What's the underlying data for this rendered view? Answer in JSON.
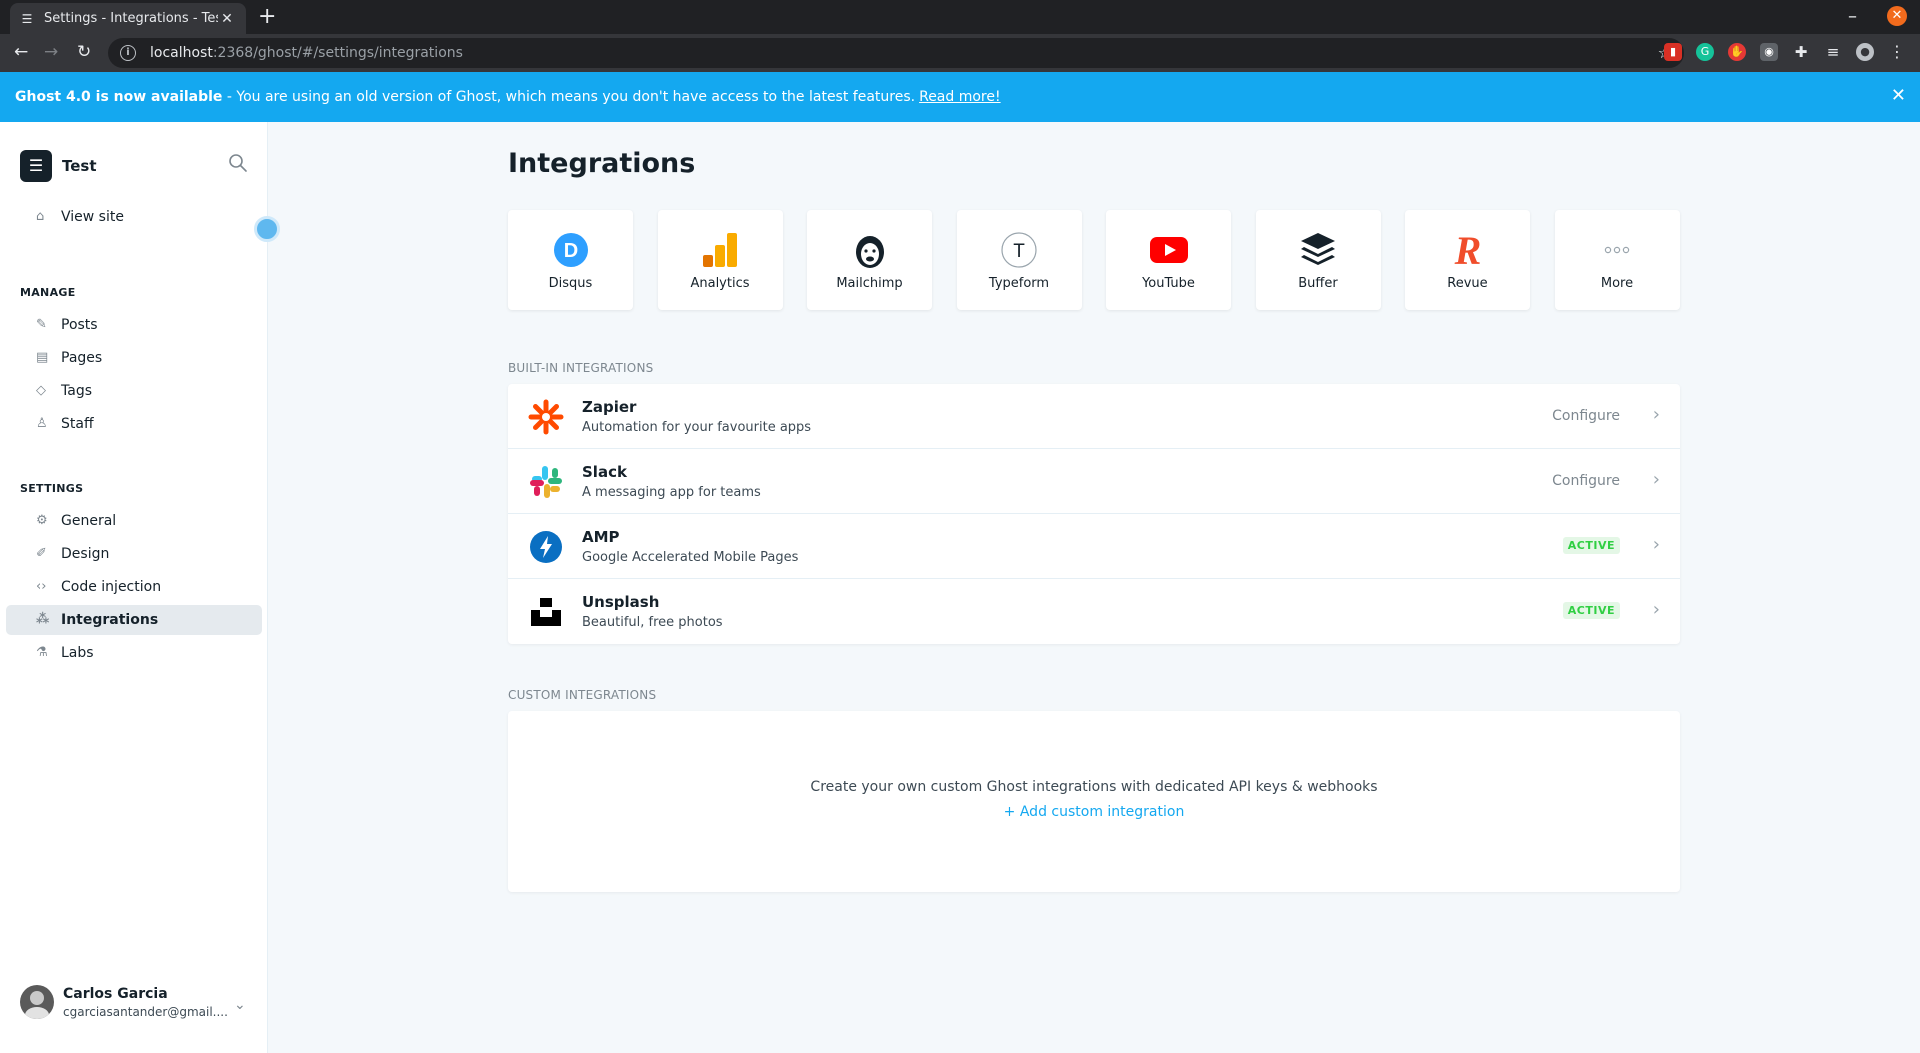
{
  "browser": {
    "tab_title": "Settings - Integrations - Test",
    "url_host": "localhost",
    "url_path": ":2368/ghost/#/settings/integrations"
  },
  "banner": {
    "bold": "Ghost 4.0 is now available",
    "text": " - You are using an old version of Ghost, which means you don't have access to the latest features.",
    "link": "Read more!"
  },
  "sidebar": {
    "site_name": "Test",
    "view_site": "View site",
    "manage_label": "MANAGE",
    "manage_items": [
      {
        "label": "Posts",
        "icon": "posts-icon"
      },
      {
        "label": "Pages",
        "icon": "pages-icon"
      },
      {
        "label": "Tags",
        "icon": "tags-icon"
      },
      {
        "label": "Staff",
        "icon": "staff-icon"
      }
    ],
    "settings_label": "SETTINGS",
    "settings_items": [
      {
        "label": "General",
        "icon": "gear-icon"
      },
      {
        "label": "Design",
        "icon": "brush-icon"
      },
      {
        "label": "Code injection",
        "icon": "code-icon"
      },
      {
        "label": "Integrations",
        "icon": "integrations-icon",
        "active": true
      },
      {
        "label": "Labs",
        "icon": "flask-icon"
      }
    ],
    "user": {
      "name": "Carlos Garcia",
      "email": "cgarciasantander@gmail...."
    }
  },
  "main": {
    "title": "Integrations",
    "apps": [
      {
        "label": "Disqus",
        "color": "#2e9fff"
      },
      {
        "label": "Analytics",
        "color": "#f9ab00"
      },
      {
        "label": "Mailchimp",
        "color": "#15212a"
      },
      {
        "label": "Typeform",
        "color": "#15212a"
      },
      {
        "label": "YouTube",
        "color": "#ff0000"
      },
      {
        "label": "Buffer",
        "color": "#15212a"
      },
      {
        "label": "Revue",
        "color": "#f04d2b"
      },
      {
        "label": "More",
        "color": "#9aa5ad"
      }
    ],
    "builtin_label": "BUILT-IN INTEGRATIONS",
    "builtin": [
      {
        "name": "Zapier",
        "desc": "Automation for your favourite apps",
        "action": "Configure"
      },
      {
        "name": "Slack",
        "desc": "A messaging app for teams",
        "action": "Configure"
      },
      {
        "name": "AMP",
        "desc": "Google Accelerated Mobile Pages",
        "badge": "ACTIVE"
      },
      {
        "name": "Unsplash",
        "desc": "Beautiful, free photos",
        "badge": "ACTIVE"
      }
    ],
    "custom_label": "CUSTOM INTEGRATIONS",
    "custom_text": "Create your own custom Ghost integrations with dedicated API keys & webhooks",
    "custom_add": "+ Add custom integration"
  }
}
